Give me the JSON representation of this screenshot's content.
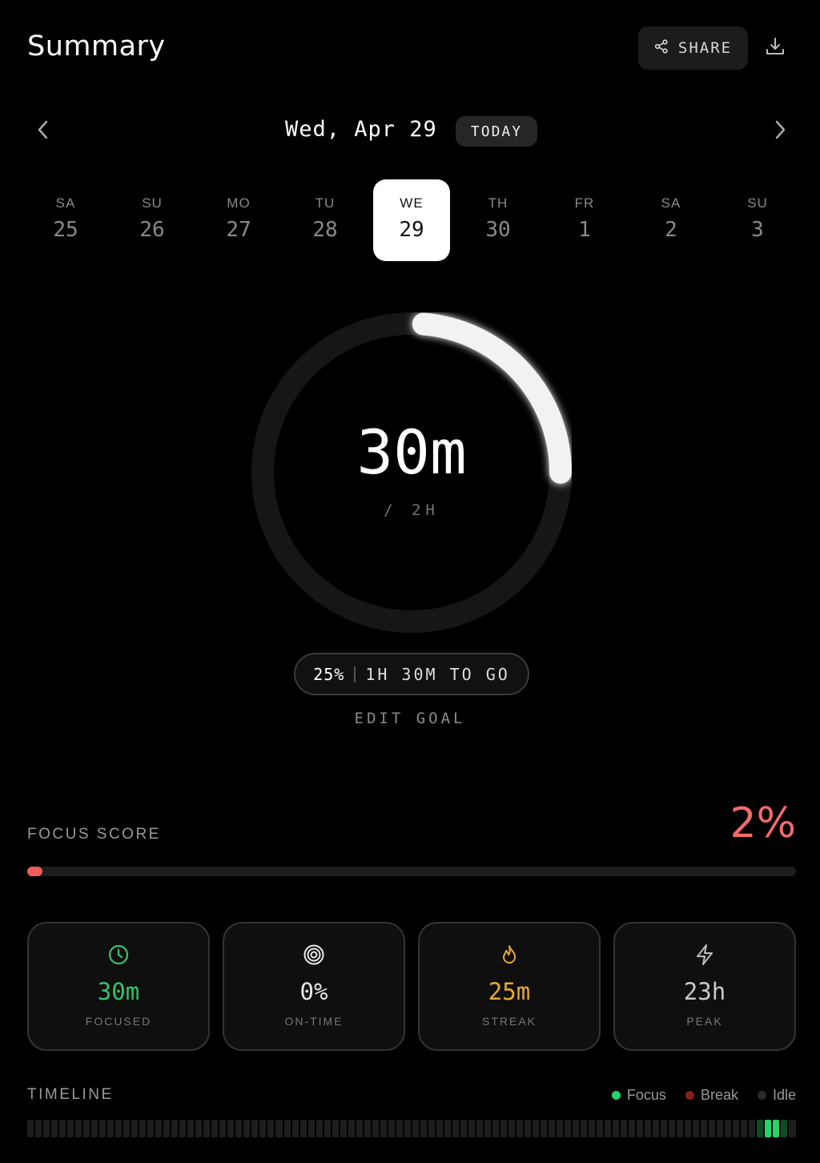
{
  "header": {
    "title": "Summary",
    "share_label": "SHARE"
  },
  "date_nav": {
    "date_label": "Wed, Apr 29",
    "today_label": "TODAY"
  },
  "week": [
    {
      "dow": "SA",
      "num": "25",
      "active": false
    },
    {
      "dow": "SU",
      "num": "26",
      "active": false
    },
    {
      "dow": "MO",
      "num": "27",
      "active": false
    },
    {
      "dow": "TU",
      "num": "28",
      "active": false
    },
    {
      "dow": "WE",
      "num": "29",
      "active": true
    },
    {
      "dow": "TH",
      "num": "30",
      "active": false
    },
    {
      "dow": "FR",
      "num": "1",
      "active": false
    },
    {
      "dow": "SA",
      "num": "2",
      "active": false
    },
    {
      "dow": "SU",
      "num": "3",
      "active": false
    }
  ],
  "goal": {
    "value": "30m",
    "target": "/ 2H",
    "progress_fraction": 0.25,
    "percent_label": "25%",
    "remaining_label": "1H 30M TO GO",
    "edit_label": "EDIT GOAL"
  },
  "focus_score": {
    "label": "FOCUS SCORE",
    "value": "2%",
    "fraction": 0.02,
    "color": "#f36b6b"
  },
  "stats": [
    {
      "icon": "clock-icon",
      "value": "30m",
      "caption": "FOCUSED",
      "color": "#35c46a"
    },
    {
      "icon": "target-icon",
      "value": "0%",
      "caption": "ON-TIME",
      "color": "#e8e8e8"
    },
    {
      "icon": "flame-icon",
      "value": "25m",
      "caption": "STREAK",
      "color": "#e8a93a"
    },
    {
      "icon": "bolt-icon",
      "value": "23h",
      "caption": "PEAK",
      "color": "#c9c9c9"
    }
  ],
  "timeline": {
    "label": "TIMELINE",
    "legend": [
      {
        "name": "Focus",
        "color": "#23d56d"
      },
      {
        "name": "Break",
        "color": "#8a1d1d"
      },
      {
        "name": "Idle",
        "color": "#2a2a2a"
      }
    ],
    "segments": 96,
    "focus_segments": [
      92,
      93
    ],
    "dim_focus_segments": [
      91,
      94
    ]
  }
}
